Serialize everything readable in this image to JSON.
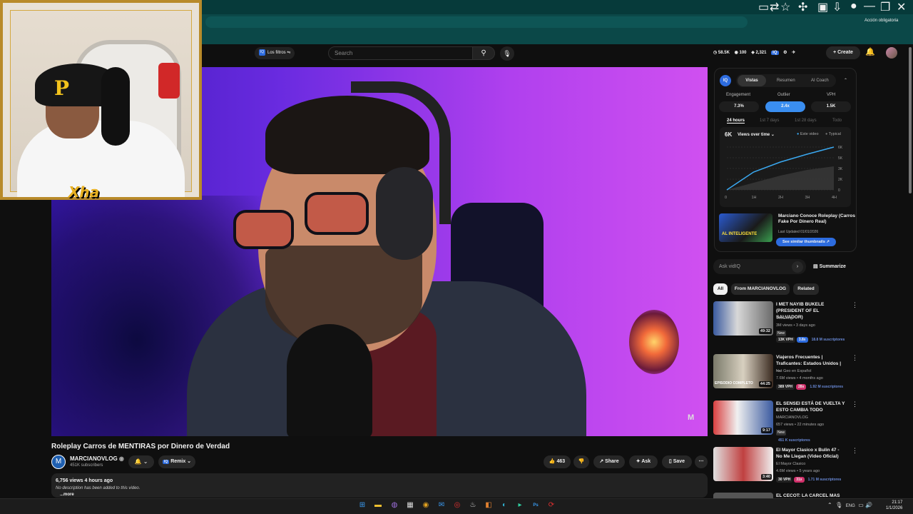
{
  "browser": {
    "window_controls": [
      "—",
      "❐",
      "✕"
    ],
    "accion_label": "Acción obligatoria"
  },
  "header": {
    "filters_label": "Los filtros",
    "filters_badge": "IQ",
    "search_placeholder": "Search",
    "stats": [
      "58.5K",
      "100",
      "2,321"
    ],
    "create_label": "Create"
  },
  "webcam": {
    "overlay_name": "Xha",
    "cap_logo": "P"
  },
  "video": {
    "title": "Roleplay Carros de MENTIRAS por Dinero de Verdad",
    "channel_name": "MARCIANOVLOG",
    "channel_avatar_letter": "M",
    "subscribers": "451K subscribers",
    "remix_label": "Remix",
    "likes": "463",
    "share_label": "Share",
    "ask_label": "Ask",
    "save_label": "Save",
    "views_line": "6,756 views  4 hours ago",
    "description": "No description has been added to this video.",
    "more_label": "...more",
    "watermark": "M"
  },
  "vidiq": {
    "logo": "IQ",
    "tabs": [
      "Vistas",
      "Resumen",
      "AI Coach"
    ],
    "metric_labels": [
      "Engagement",
      "Outlier",
      "VPH"
    ],
    "metric_values": [
      "7.3%",
      "2.4x",
      "1.5K"
    ],
    "ranges": [
      "24 hours",
      "1st 7 days",
      "1st 28 days",
      "Todo"
    ],
    "chart_headline": "6K",
    "chart_dropdown": "Views over time",
    "legend": [
      "Este video",
      "Typical"
    ],
    "video_title": "Marciano Conoce Roleplay (Carros Fake Por Dinero Real)",
    "last_updated": "Last Updated 01/01/2026",
    "similar_button": "See similar thumbnails",
    "thumb_text": "AL INTELIGENTE",
    "ask_placeholder": "Ask vidIQ",
    "summarize_label": "Summarize"
  },
  "chart_data": {
    "type": "area",
    "x": [
      "0",
      "1H",
      "2H",
      "3H",
      "4H"
    ],
    "yticks": [
      "0",
      "2K",
      "3K",
      "5K",
      "6K"
    ],
    "series": [
      {
        "name": "Este video",
        "values": [
          0,
          2500,
          3900,
          5000,
          6000
        ]
      },
      {
        "name": "Typical",
        "values": [
          0,
          1000,
          2000,
          2800,
          3300
        ]
      }
    ],
    "ylim": [
      0,
      6000
    ]
  },
  "chips": [
    "All",
    "From MARCIANOVLOG",
    "Related"
  ],
  "related": [
    {
      "title": "I MET NAYIB BUKELE (PRESIDENT OF EL SALVADOR)",
      "channel": "TheGrefg",
      "meta": "3M views • 3 days ago",
      "duration": "49:32",
      "new": "New",
      "tags": [
        "13K VPH",
        "3.8x",
        "18.8 M suscriptores"
      ]
    },
    {
      "title": "Viajeros Frecuentes | Traficantes: Estados Unidos | ...",
      "channel": "Nat Geo en Español",
      "meta": "7.6M views • 4 months ago",
      "duration": "44:25",
      "thumb_text": "EPISODIO COMPLETO",
      "tags": [
        "389 VPH",
        "28x",
        "1.92 M suscriptores"
      ]
    },
    {
      "title": "EL SENSEI ESTÁ DE VUELTA Y ESTO CAMBIA TODO",
      "channel": "MARCIANOVLOG",
      "meta": "657 views • 22 minutes ago",
      "duration": "9:17",
      "new": "New",
      "tags": [
        "451 K suscriptores"
      ]
    },
    {
      "title": "El Mayor Clasico x Bulin 47 - No Me Llegan (Video Oficial)",
      "channel": "El Mayor Clasico",
      "meta": "4.6M views • 5 years ago",
      "duration": "3:40",
      "tags": [
        "30 VPH",
        "31x",
        "1.71 M suscriptores"
      ]
    },
    {
      "title": "EL CECOT: LA CARCEL MAS",
      "channel": "",
      "meta": "",
      "duration": "",
      "tags": []
    }
  ],
  "taskbar": {
    "lang": "ENG",
    "time": "21:17",
    "date": "1/1/2026"
  }
}
